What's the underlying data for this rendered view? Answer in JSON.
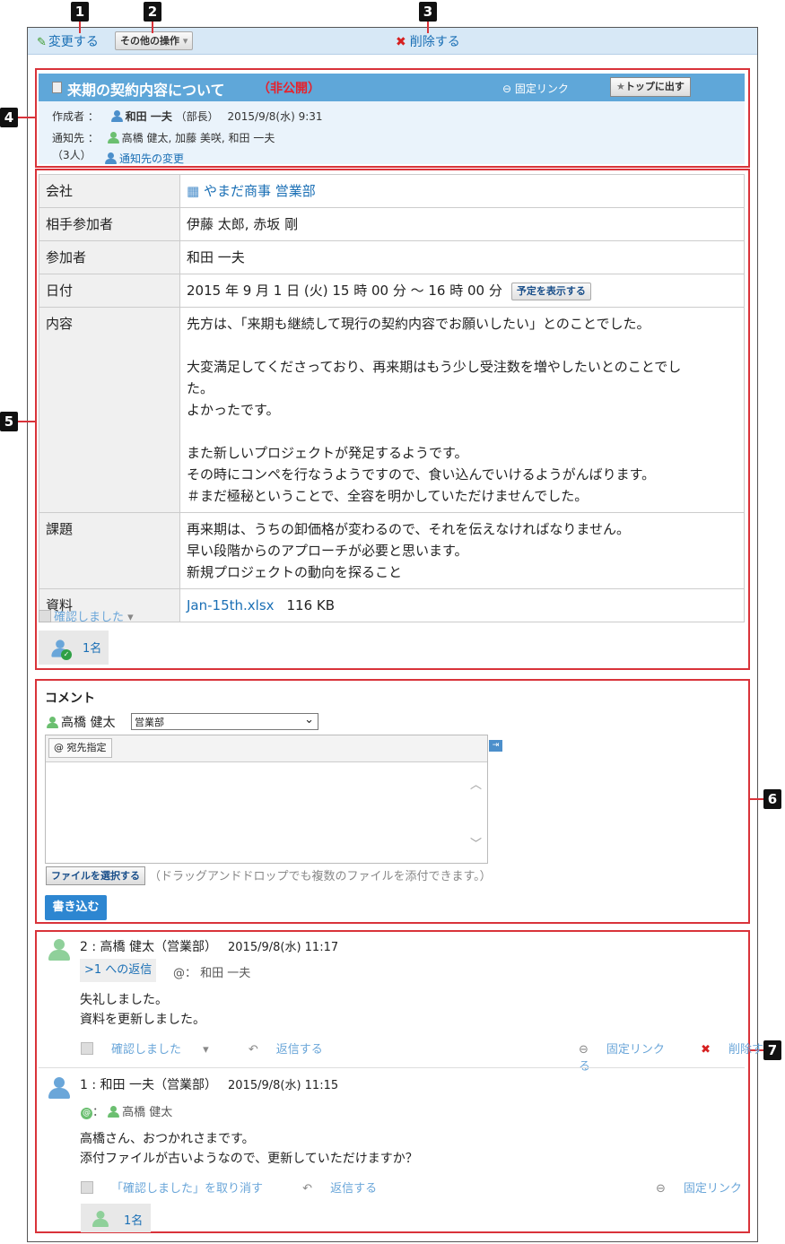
{
  "callouts": [
    "1",
    "2",
    "3",
    "4",
    "5",
    "6",
    "7"
  ],
  "toolbar": {
    "edit_label": "変更する",
    "other_ops_label": "その他の操作",
    "delete_label": "削除する"
  },
  "record": {
    "title": "来期の契約内容について",
    "visibility": "（非公開）",
    "fixed_link_label": "固定リンク",
    "top_button_label": "トップに出す",
    "author_label": "作成者 ：",
    "author_name": "和田 一夫",
    "author_title": "（部長）",
    "author_date": "2015/9/8(水) 9:31",
    "notify_label": "通知先 ：",
    "notify_count": "（3人）",
    "notify_names": "高橋 健太, 加藤 美咲, 和田 一夫",
    "notify_change_label": "通知先の変更"
  },
  "fields": {
    "company_label": "会社",
    "company_value": "やまだ商事 営業部",
    "counterpart_label": "相手参加者",
    "counterpart_value": "伊藤 太郎, 赤坂 剛",
    "participant_label": "参加者",
    "participant_value": "和田 一夫",
    "date_label": "日付",
    "date_value": "2015 年 9 月 1 日 (火) 15 時 00 分 〜 16 時 00 分",
    "show_schedule_label": "予定を表示する",
    "content_label": "内容",
    "content_lines": [
      "先方は、「来期も継続して現行の契約内容でお願いしたい」とのことでした。",
      "",
      "大変満足してくださっており、再来期はもう少し受注数を増やしたいとのことでし",
      "た。",
      "よかったです。",
      "",
      "また新しいプロジェクトが発足するようです。",
      "その時にコンペを行なうようですので、食い込んでいけるようがんばります。",
      "＃まだ極秘ということで、全容を明かしていただけませんでした。"
    ],
    "issue_label": "課題",
    "issue_lines": [
      "再来期は、うちの卸価格が変わるので、それを伝えなければなりません。",
      "早い段階からのアプローチが必要と思います。",
      "新規プロジェクトの動向を探ること"
    ],
    "material_label": "資料",
    "material_file": "Jan-15th.xlsx",
    "material_size": "116 KB"
  },
  "confirm": {
    "label": "確認しました",
    "count": "1名"
  },
  "comment_form": {
    "title": "コメント",
    "poster": "高橋 健太",
    "dept": "営業部",
    "mention_label": "@ 宛先指定",
    "file_button": "ファイルを選択する",
    "file_hint": "（ドラッグアンドドロップでも複数のファイルを添付できます。）",
    "submit_label": "書き込む"
  },
  "comments": [
    {
      "no": "2",
      "author": "高橋 健太",
      "dept": "（営業部）",
      "date": "2015/9/8(水) 11:17",
      "reply_to": ">1 への返信",
      "mention_prefix": "@：",
      "mention": "和田 一夫",
      "lines": [
        "失礼しました。",
        "資料を更新しました。"
      ],
      "confirm_label": "確認しました",
      "reply_label": "返信する",
      "link_label": "固定リンク",
      "delete_label": "削除する"
    },
    {
      "no": "1",
      "author": "和田 一夫",
      "dept": "（営業部）",
      "date": "2015/9/8(水) 11:15",
      "mention_prefix": "@",
      "mention_sep": "：",
      "mention": "高橋 健太",
      "lines": [
        "高橋さん、おつかれさまです。",
        "添付ファイルが古いようなので、更新していただけますか？"
      ],
      "undo_label": "「確認しました」を取り消す",
      "reply_label": "返信する",
      "link_label": "固定リンク",
      "readers": "1名"
    }
  ]
}
